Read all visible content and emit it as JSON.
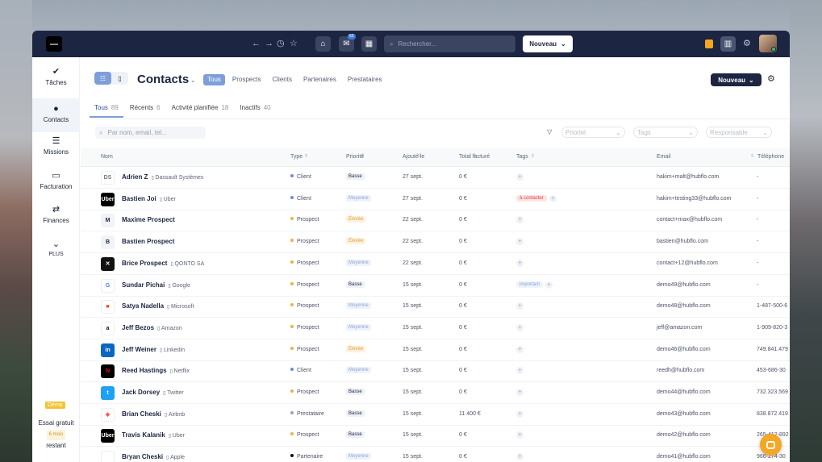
{
  "topbar": {
    "search_placeholder": "Rechercher...",
    "new_button": "Nouveau",
    "mail_badge": "63"
  },
  "sidebar": {
    "items": [
      {
        "label": "Tâches",
        "icon": "check-icon"
      },
      {
        "label": "Contacts",
        "icon": "person-icon"
      },
      {
        "label": "Missions",
        "icon": "list-icon"
      },
      {
        "label": "Facturation",
        "icon": "bill-icon"
      },
      {
        "label": "Finances",
        "icon": "transfer-icon"
      },
      {
        "label": "PLUS",
        "icon": "chevron-down-icon"
      }
    ],
    "demo": "Démo",
    "trial_line1": "Essai gratuit",
    "trial_duration": "6 mois",
    "trial_line2": "restant"
  },
  "header": {
    "title": "Contacts",
    "new_button": "Nouveau",
    "filters": [
      "Tous",
      "Prospects",
      "Clients",
      "Partenaires",
      "Prestataires"
    ]
  },
  "tabs": [
    {
      "label": "Tous",
      "count": "89"
    },
    {
      "label": "Récents",
      "count": "6"
    },
    {
      "label": "Activité planifiée",
      "count": "18"
    },
    {
      "label": "Inactifs",
      "count": "40"
    }
  ],
  "filterbar": {
    "search_placeholder": "Par nom, email, tel...",
    "priority": "Priorité",
    "tags": "Tags",
    "owner": "Responsable"
  },
  "table": {
    "columns": [
      "Nom",
      "Type",
      "Priorité",
      "Ajouté le",
      "Total facturé",
      "Tags",
      "Email",
      "Téléphone"
    ],
    "rows": [
      {
        "name": "Adrien Z",
        "company": "Dassault Systèmes",
        "type": "Client",
        "priority": "Basse",
        "added": "27 sept.",
        "total": "0 €",
        "tags": [],
        "email": "hakim+malt@hubflo.com",
        "phone": "-"
      },
      {
        "name": "Bastien Joi",
        "company": "Uber",
        "type": "Client",
        "priority": "Moyenne",
        "added": "27 sept.",
        "total": "0 €",
        "tags": [
          "à contacter"
        ],
        "email": "hakim+testing33@hubflo.com",
        "phone": "-"
      },
      {
        "name": "Maxime Prospect",
        "company": "",
        "type": "Prospect",
        "priority": "Élevée",
        "added": "22 sept.",
        "total": "0 €",
        "tags": [],
        "email": "contact+max@hubflo.com",
        "phone": "-"
      },
      {
        "name": "Bastien Prospect",
        "company": "",
        "type": "Prospect",
        "priority": "Élevée",
        "added": "22 sept.",
        "total": "0 €",
        "tags": [],
        "email": "bastien@hubflo.com",
        "phone": "-"
      },
      {
        "name": "Brice Prospect",
        "company": "QONTO SA",
        "type": "Prospect",
        "priority": "Moyenne",
        "added": "22 sept.",
        "total": "0 €",
        "tags": [],
        "email": "contact+12@hubflo.com",
        "phone": "-"
      },
      {
        "name": "Sundar Pichai",
        "company": "Google",
        "type": "Prospect",
        "priority": "Basse",
        "added": "15 sept.",
        "total": "0 €",
        "tags": [
          "important"
        ],
        "email": "demo49@hubflo.com",
        "phone": "-"
      },
      {
        "name": "Satya Nadella",
        "company": "Microsoft",
        "type": "Prospect",
        "priority": "Moyenne",
        "added": "15 sept.",
        "total": "0 €",
        "tags": [],
        "email": "demo48@hubflo.com",
        "phone": "1-487-500-6"
      },
      {
        "name": "Jeff Bezos",
        "company": "Amazon",
        "type": "Prospect",
        "priority": "Moyenne",
        "added": "15 sept.",
        "total": "0 €",
        "tags": [],
        "email": "jeff@amazon.com",
        "phone": "1-909-820-3"
      },
      {
        "name": "Jeff Weiner",
        "company": "Linkedin",
        "type": "Prospect",
        "priority": "Élevée",
        "added": "15 sept.",
        "total": "0 €",
        "tags": [],
        "email": "demo46@hubflo.com",
        "phone": "749.841.479"
      },
      {
        "name": "Reed Hastings",
        "company": "Netflix",
        "type": "Client",
        "priority": "Moyenne",
        "added": "15 sept.",
        "total": "0 €",
        "tags": [],
        "email": "reedh@hubflo.com",
        "phone": "453-686-30"
      },
      {
        "name": "Jack Dorsey",
        "company": "Twitter",
        "type": "Prospect",
        "priority": "Basse",
        "added": "15 sept.",
        "total": "0 €",
        "tags": [],
        "email": "demo44@hubflo.com",
        "phone": "732.323.569"
      },
      {
        "name": "Brian Cheski",
        "company": "Airbnb",
        "type": "Prestataire",
        "priority": "Basse",
        "added": "15 sept.",
        "total": "11 400 €",
        "tags": [],
        "email": "demo43@hubflo.com",
        "phone": "838.872.419"
      },
      {
        "name": "Travis Kalanik",
        "company": "Uber",
        "type": "Prospect",
        "priority": "Basse",
        "added": "15 sept.",
        "total": "0 €",
        "tags": [],
        "email": "demo42@hubflo.com",
        "phone": "265-412-892"
      },
      {
        "name": "Bryan Cheski",
        "company": "Apple",
        "type": "Partenaire",
        "priority": "Moyenne",
        "added": "15 sept.",
        "total": "0 €",
        "tags": [],
        "email": "demo41@hubflo.com",
        "phone": "966-274-30"
      }
    ]
  },
  "logos": [
    {
      "text": "DS",
      "bg": "#ffffff",
      "fg": "#777777"
    },
    {
      "text": "Uber",
      "bg": "#000000",
      "fg": "#ffffff"
    },
    {
      "text": "M",
      "bg": "#f1f3f7",
      "fg": "#1c2541"
    },
    {
      "text": "B",
      "bg": "#f1f3f7",
      "fg": "#1c2541"
    },
    {
      "text": "✕",
      "bg": "#111111",
      "fg": "#ffffff"
    },
    {
      "text": "G",
      "bg": "#ffffff",
      "fg": "#4285f4"
    },
    {
      "text": "■",
      "bg": "#ffffff",
      "fg": "#f25022"
    },
    {
      "text": "a",
      "bg": "#ffffff",
      "fg": "#111111"
    },
    {
      "text": "in",
      "bg": "#0a66c2",
      "fg": "#ffffff"
    },
    {
      "text": "N",
      "bg": "#000000",
      "fg": "#e50914"
    },
    {
      "text": "t",
      "bg": "#1da1f2",
      "fg": "#ffffff"
    },
    {
      "text": "◆",
      "bg": "#ffffff",
      "fg": "#ff5a5f"
    },
    {
      "text": "Uber",
      "bg": "#000000",
      "fg": "#ffffff"
    },
    {
      "text": "",
      "bg": "#ffffff",
      "fg": "#111111"
    }
  ],
  "colors": {
    "navy": "#1c2541",
    "accent": "#7e9ed9",
    "client": "#6b8fd6",
    "prospect": "#f0b048",
    "prestataire": "#9aa3b8",
    "partenaire": "#111111"
  }
}
